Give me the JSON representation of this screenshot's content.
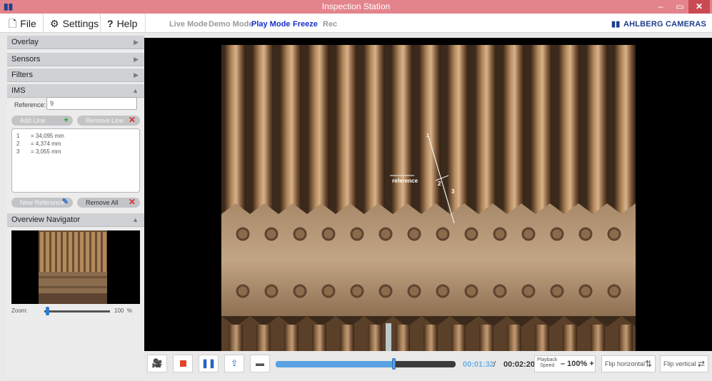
{
  "window": {
    "title": "Inspection Station",
    "controls": {
      "minimize": "–",
      "maximize": "▭",
      "close": "✕"
    }
  },
  "menu": {
    "file": "File",
    "settings": "Settings",
    "help": "Help"
  },
  "modes": [
    {
      "label": "Live Mode",
      "active": false
    },
    {
      "label": "Demo Mode",
      "active": false
    },
    {
      "label": "Play Mode",
      "active": true
    },
    {
      "label": "Freeze",
      "active": true
    },
    {
      "label": "Rec",
      "active": false
    }
  ],
  "brand": "AHLBERG CAMERAS",
  "sidebar": {
    "sections": [
      {
        "label": "Overlay",
        "expanded": false
      },
      {
        "label": "Sensors",
        "expanded": false
      },
      {
        "label": "Filters",
        "expanded": false
      },
      {
        "label": "IMS",
        "expanded": true
      }
    ],
    "ims": {
      "reference_label": "Reference:",
      "reference_value": "9",
      "add_line": "Add Line",
      "remove_line": "Remove Line",
      "lines": [
        {
          "n": "1",
          "value": "= 34,095 mm"
        },
        {
          "n": "2",
          "value": "= 4,374 mm"
        },
        {
          "n": "3",
          "value": "= 3,055 mm"
        }
      ],
      "new_reference": "New Reference",
      "remove_all": "Remove All"
    },
    "navigator": {
      "title": "Overview Navigator",
      "zoom_label": "Zoom:",
      "zoom_value": "100",
      "zoom_unit": "%",
      "zoom_fraction": 0.03
    }
  },
  "overlay": {
    "reference_label": "reference",
    "markers": [
      "1",
      "2",
      "3"
    ]
  },
  "playback": {
    "current_time": "00:01:32",
    "separator": "/",
    "total_time": "00:02:20",
    "progress_fraction": 0.657,
    "speed_label_1": "Playback",
    "speed_label_2": "Speed",
    "speed_value": "– 100% +",
    "flip_horizontal": "Flip horizontal",
    "flip_vertical": "Flip vertical"
  },
  "colors": {
    "titlebar": "#e3848c",
    "active_mode": "#1530c8",
    "progress": "#5aa2e3",
    "brand": "#1f3f8c"
  }
}
